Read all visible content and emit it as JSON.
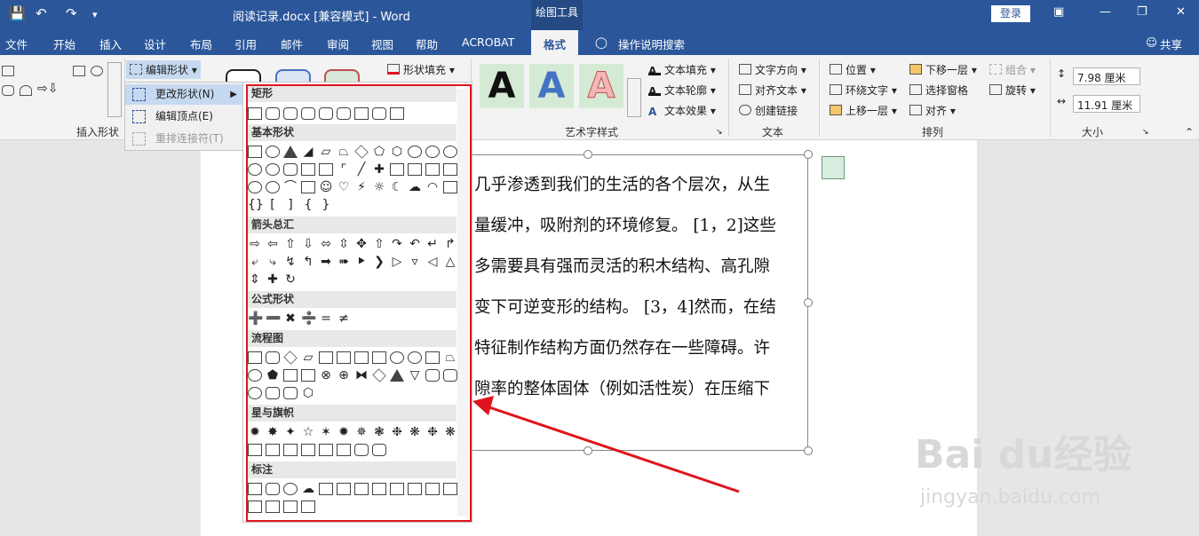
{
  "titlebar": {
    "doc_title": "阅读记录.docx [兼容模式]  -  Word",
    "context_tab": "绘图工具",
    "login": "登录"
  },
  "tabs": [
    "文件",
    "开始",
    "插入",
    "设计",
    "布局",
    "引用",
    "邮件",
    "审阅",
    "视图",
    "帮助",
    "ACROBAT",
    "格式",
    "操作说明搜索",
    "共享"
  ],
  "ribbon": {
    "edit_shape": "编辑形状",
    "insert_shapes_label": "插入形状",
    "shape_fill": "形状填充",
    "art_label": "艺术字样式",
    "text_fill": "文本填充",
    "text_outline": "文本轮廓",
    "text_effect": "文本效果",
    "text_dir": "文字方向",
    "align_text": "对齐文本",
    "create_link": "创建链接",
    "text_label": "文本",
    "position": "位置",
    "wrap_text": "环绕文字",
    "bring_forward": "上移一层",
    "send_backward": "下移一层",
    "selection_pane": "选择窗格",
    "align": "对齐",
    "group": "组合",
    "rotate": "旋转",
    "arrange_label": "排列",
    "height": "7.98 厘米",
    "width": "11.91 厘米",
    "size_label": "大小",
    "art_letter": "A"
  },
  "menu": {
    "change_shape": "更改形状(N)",
    "edit_points": "编辑顶点(E)",
    "reroute": "重排连接符(T)"
  },
  "gallery": {
    "rect": "矩形",
    "basic": "基本形状",
    "arrows": "箭头总汇",
    "equation": "公式形状",
    "flowchart": "流程图",
    "stars": "星与旗帜",
    "callouts": "标注"
  },
  "document": {
    "lines": [
      "几乎渗透到我们的生活的各个层次，从生",
      "量缓冲，吸附剂的环境修复。 [1，2]这些",
      "多需要具有强而灵活的积木结构、高孔隙",
      "变下可逆变形的结构。 [3，4]然而，在结",
      "特征制作结构方面仍然存在一些障碍。许",
      "隙率的整体固体（例如活性炭）在压缩下"
    ]
  },
  "watermark": {
    "brand": "Bai du经验",
    "url": "jingyan.baidu.com"
  },
  "colors": {
    "accent": "#2b579a",
    "highlight": "#e0141e"
  }
}
